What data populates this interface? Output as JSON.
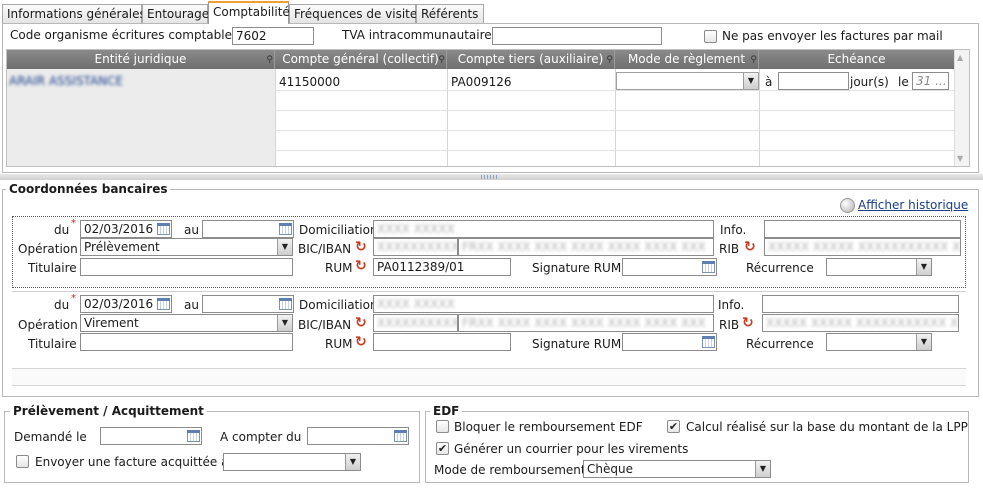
{
  "tabs": [
    {
      "label": "Informations générales",
      "active": false
    },
    {
      "label": "Entourage",
      "active": false
    },
    {
      "label": "Comptabilité",
      "active": true
    },
    {
      "label": "Fréquences de visites",
      "active": false
    },
    {
      "label": "Référents",
      "active": false
    }
  ],
  "compta": {
    "code_org_label": "Code organisme écritures comptables",
    "code_org_value": "7602",
    "tva_label": "TVA intracommunautaire",
    "tva_value": "",
    "no_mail_label": "Ne pas envoyer les factures par mail",
    "no_mail_checked": false
  },
  "grid": {
    "headers": [
      "Entité juridique",
      "Compte général (collectif)",
      "Compte tiers (auxiliaire)",
      "Mode de règlement",
      "Echéance"
    ],
    "row": {
      "entite": "ARAIR ASSISTANCE",
      "compte_general": "41150000",
      "compte_tiers": "PA009126",
      "mode_reglement": "",
      "a_label": "à",
      "jours_value": "",
      "jours_label": "jour(s)",
      "le_label": "le",
      "le_placeholder": "31 ..."
    }
  },
  "bank": {
    "title": "Coordonnées bancaires",
    "history_link": "Afficher historique",
    "labels": {
      "du": "du",
      "au": "au",
      "domiciliation": "Domiciliation",
      "info": "Info.",
      "operation": "Opération",
      "bic_iban": "BIC/IBAN",
      "rib": "RIB",
      "titulaire": "Titulaire",
      "rum": "RUM",
      "signature_rum": "Signature RUM",
      "recurrence": "Récurrence"
    },
    "blocks": [
      {
        "du": "02/03/2016",
        "au": "",
        "domiciliation": "XXXX XXXXX",
        "info": "",
        "operation": "Prélèvement",
        "bic": "XXXXXXXXXXX",
        "iban": "FRXX XXXX XXXX XXXX XXXX XXXX XXX",
        "rib": "XXXXX XXXXX XXXXXXXXXXX XX",
        "titulaire": "",
        "rum": "PA0112389/01",
        "signature_rum": "",
        "recurrence": ""
      },
      {
        "du": "02/03/2016",
        "au": "",
        "domiciliation": "XXXX XXXXX",
        "info": "",
        "operation": "Virement",
        "bic": "XXXXXXXXXXX",
        "iban": "FRXX XXXX XXXX XXXX XXXX XXXX XXX",
        "rib": "XXXXX XXXXX XXXXXXXXXXX XX",
        "titulaire": "",
        "rum": "",
        "signature_rum": "",
        "recurrence": ""
      }
    ]
  },
  "prelevement": {
    "title": "Prélèvement / Acquittement",
    "demande_label": "Demandé le",
    "demande_value": "",
    "a_compter_label": "A compter du",
    "a_compter_value": "",
    "envoyer_label": "Envoyer une facture acquittée à",
    "envoyer_checked": false,
    "envoyer_value": ""
  },
  "edf": {
    "title": "EDF",
    "bloquer_label": "Bloquer le remboursement EDF",
    "bloquer_checked": false,
    "calcul_label": "Calcul réalisé sur la base du montant de la LPP",
    "calcul_checked": true,
    "generer_label": "Générer un courrier pour les virements",
    "generer_checked": true,
    "mode_label": "Mode de remboursement",
    "mode_value": "Chèque"
  },
  "colors": {
    "tab_accent": "#f0a030",
    "grid_header": "#7a7a7a",
    "link": "#1a3e8a",
    "required": "#cc2222"
  }
}
